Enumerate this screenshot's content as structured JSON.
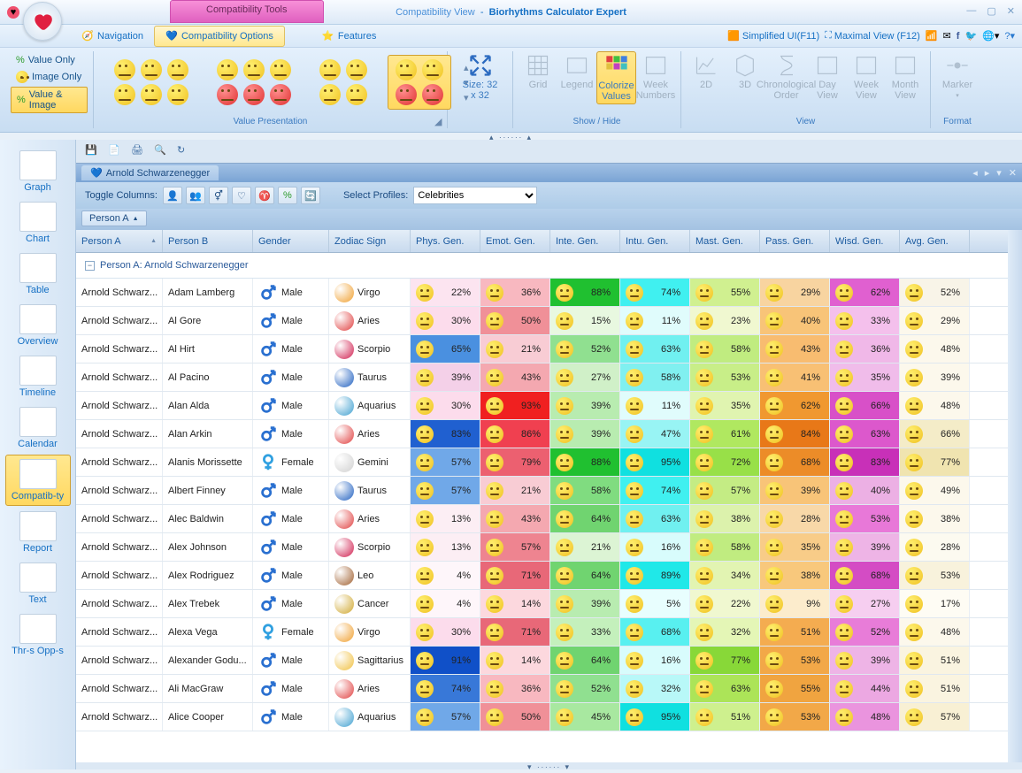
{
  "window": {
    "view_label": "Compatibility View",
    "separator": "-",
    "app_name": "Biorhythms Calculator Expert",
    "contextual_tab": "Compatibility Tools"
  },
  "tabs": {
    "navigation": "Navigation",
    "compat_options": "Compatibility Options",
    "features": "Features"
  },
  "topright": {
    "simplified": "Simplified UI(F11)",
    "maximal": "Maximal View (F12)"
  },
  "ribbon": {
    "value_presentation": {
      "label": "Value Presentation",
      "value_only": "Value Only",
      "image_only": "Image Only",
      "value_image": "Value & Image"
    },
    "size": {
      "label": "Size: 32 x 32"
    },
    "show_hide": {
      "label": "Show / Hide",
      "grid": "Grid",
      "legend": "Legend",
      "colorize": "Colorize Values",
      "week_numbers": "Week Numbers"
    },
    "view": {
      "label": "View",
      "d2": "2D",
      "d3": "3D",
      "chrono": "Chronological Order",
      "day": "Day View",
      "week": "Week View",
      "month": "Month View"
    },
    "format": {
      "label": "Format",
      "marker": "Marker"
    }
  },
  "sidebar": {
    "items": [
      "Graph",
      "Chart",
      "Table",
      "Overview",
      "Timeline",
      "Calendar",
      "Compatib-ty",
      "Report",
      "Text",
      "Thr-s Opp-s"
    ],
    "selected_index": 6
  },
  "doc_tab": {
    "title": "Arnold Schwarzenegger"
  },
  "filterbar": {
    "toggle_columns": "Toggle Columns:",
    "select_profiles": "Select Profiles:",
    "profiles_value": "Celebrities"
  },
  "groupby": {
    "chip": "Person A"
  },
  "columns": [
    "Person A",
    "Person B",
    "Gender",
    "Zodiac Sign",
    "Phys. Gen.",
    "Emot. Gen.",
    "Inte. Gen.",
    "Intu. Gen.",
    "Mast. Gen.",
    "Pass. Gen.",
    "Wisd. Gen.",
    "Avg. Gen."
  ],
  "group_header": "Person A:  Arnold Schwarzenegger",
  "rows": [
    {
      "a": "Arnold Schwarz...",
      "b": "Adam Lamberg",
      "gender": "Male",
      "zodiac": "Virgo",
      "zod_color": "#f0a030",
      "vals": [
        {
          "p": "22%",
          "c": "#fce4f0"
        },
        {
          "p": "36%",
          "c": "#f8b8c0"
        },
        {
          "p": "88%",
          "c": "#20c030"
        },
        {
          "p": "74%",
          "c": "#40f0f0"
        },
        {
          "p": "55%",
          "c": "#d0f090"
        },
        {
          "p": "29%",
          "c": "#f8d4a0"
        },
        {
          "p": "62%",
          "c": "#e060d0"
        },
        {
          "p": "52%",
          "c": "#f8f4e8"
        }
      ]
    },
    {
      "a": "Arnold Schwarz...",
      "b": "Al Gore",
      "gender": "Male",
      "zodiac": "Aries",
      "zod_color": "#e04040",
      "vals": [
        {
          "p": "30%",
          "c": "#fcdcec"
        },
        {
          "p": "50%",
          "c": "#f09098"
        },
        {
          "p": "15%",
          "c": "#e8f8e0"
        },
        {
          "p": "11%",
          "c": "#e0fcfc"
        },
        {
          "p": "23%",
          "c": "#f0f8d0"
        },
        {
          "p": "40%",
          "c": "#f8c478"
        },
        {
          "p": "33%",
          "c": "#f4c0ec"
        },
        {
          "p": "29%",
          "c": "#fcf8ec"
        }
      ]
    },
    {
      "a": "Arnold Schwarz...",
      "b": "Al Hirt",
      "gender": "Male",
      "zodiac": "Scorpio",
      "zod_color": "#d02050",
      "vals": [
        {
          "p": "65%",
          "c": "#4a90e0"
        },
        {
          "p": "21%",
          "c": "#f8ccd4"
        },
        {
          "p": "52%",
          "c": "#90e090"
        },
        {
          "p": "63%",
          "c": "#70f0f0"
        },
        {
          "p": "58%",
          "c": "#c0ec80"
        },
        {
          "p": "43%",
          "c": "#f8bc70"
        },
        {
          "p": "36%",
          "c": "#f0b8e8"
        },
        {
          "p": "48%",
          "c": "#fcf8ec"
        }
      ]
    },
    {
      "a": "Arnold Schwarz...",
      "b": "Al Pacino",
      "gender": "Male",
      "zodiac": "Taurus",
      "zod_color": "#2060c0",
      "vals": [
        {
          "p": "39%",
          "c": "#f4d0e8"
        },
        {
          "p": "43%",
          "c": "#f4a8b0"
        },
        {
          "p": "27%",
          "c": "#d0f0c8"
        },
        {
          "p": "58%",
          "c": "#80f0f0"
        },
        {
          "p": "53%",
          "c": "#c8ee88"
        },
        {
          "p": "41%",
          "c": "#f8c074"
        },
        {
          "p": "35%",
          "c": "#f0bcea"
        },
        {
          "p": "39%",
          "c": "#fcf8ec"
        }
      ]
    },
    {
      "a": "Arnold Schwarz...",
      "b": "Alan Alda",
      "gender": "Male",
      "zodiac": "Aquarius",
      "zod_color": "#40a0d0",
      "vals": [
        {
          "p": "30%",
          "c": "#fcdcec"
        },
        {
          "p": "93%",
          "c": "#f02020"
        },
        {
          "p": "39%",
          "c": "#b8ecb0"
        },
        {
          "p": "11%",
          "c": "#e0fcfc"
        },
        {
          "p": "35%",
          "c": "#e0f4b0"
        },
        {
          "p": "62%",
          "c": "#f09830"
        },
        {
          "p": "66%",
          "c": "#d850c8"
        },
        {
          "p": "48%",
          "c": "#fcf8ec"
        }
      ]
    },
    {
      "a": "Arnold Schwarz...",
      "b": "Alan Arkin",
      "gender": "Male",
      "zodiac": "Aries",
      "zod_color": "#e04040",
      "vals": [
        {
          "p": "83%",
          "c": "#2060d0"
        },
        {
          "p": "86%",
          "c": "#f04050"
        },
        {
          "p": "39%",
          "c": "#b8ecb0"
        },
        {
          "p": "47%",
          "c": "#98f4f4"
        },
        {
          "p": "61%",
          "c": "#b0e860"
        },
        {
          "p": "84%",
          "c": "#e87818"
        },
        {
          "p": "63%",
          "c": "#dc58cc"
        },
        {
          "p": "66%",
          "c": "#f4ecc8"
        }
      ]
    },
    {
      "a": "Arnold Schwarz...",
      "b": "Alanis Morissette",
      "gender": "Female",
      "zodiac": "Gemini",
      "zod_color": "#d0d0d0",
      "vals": [
        {
          "p": "57%",
          "c": "#70a8e8"
        },
        {
          "p": "79%",
          "c": "#ec6070"
        },
        {
          "p": "88%",
          "c": "#20c030"
        },
        {
          "p": "95%",
          "c": "#10e0e0"
        },
        {
          "p": "72%",
          "c": "#98e048"
        },
        {
          "p": "68%",
          "c": "#ec8c28"
        },
        {
          "p": "83%",
          "c": "#c830b8"
        },
        {
          "p": "77%",
          "c": "#f0e4b0"
        }
      ]
    },
    {
      "a": "Arnold Schwarz...",
      "b": "Albert Finney",
      "gender": "Male",
      "zodiac": "Taurus",
      "zod_color": "#2060c0",
      "vals": [
        {
          "p": "57%",
          "c": "#70a8e8"
        },
        {
          "p": "21%",
          "c": "#f8ccd4"
        },
        {
          "p": "58%",
          "c": "#80dc80"
        },
        {
          "p": "74%",
          "c": "#40f0f0"
        },
        {
          "p": "57%",
          "c": "#c4ec84"
        },
        {
          "p": "39%",
          "c": "#f8c478"
        },
        {
          "p": "40%",
          "c": "#ecb0e4"
        },
        {
          "p": "49%",
          "c": "#fcf8ec"
        }
      ]
    },
    {
      "a": "Arnold Schwarz...",
      "b": "Alec Baldwin",
      "gender": "Male",
      "zodiac": "Aries",
      "zod_color": "#e04040",
      "vals": [
        {
          "p": "13%",
          "c": "#fceef4"
        },
        {
          "p": "43%",
          "c": "#f4a8b0"
        },
        {
          "p": "64%",
          "c": "#70d470"
        },
        {
          "p": "63%",
          "c": "#70f0f0"
        },
        {
          "p": "38%",
          "c": "#dcf2ac"
        },
        {
          "p": "28%",
          "c": "#f8d8a8"
        },
        {
          "p": "53%",
          "c": "#e878d8"
        },
        {
          "p": "38%",
          "c": "#fcf8ec"
        }
      ]
    },
    {
      "a": "Arnold Schwarz...",
      "b": "Alex Johnson",
      "gender": "Male",
      "zodiac": "Scorpio",
      "zod_color": "#d02050",
      "vals": [
        {
          "p": "13%",
          "c": "#fceef4"
        },
        {
          "p": "57%",
          "c": "#ee8490"
        },
        {
          "p": "21%",
          "c": "#dcf4d4"
        },
        {
          "p": "16%",
          "c": "#d8fcfc"
        },
        {
          "p": "58%",
          "c": "#c0ec80"
        },
        {
          "p": "35%",
          "c": "#f8cc88"
        },
        {
          "p": "39%",
          "c": "#eeb4e6"
        },
        {
          "p": "28%",
          "c": "#fcfaf0"
        }
      ]
    },
    {
      "a": "Arnold Schwarz...",
      "b": "Alex Rodriguez",
      "gender": "Male",
      "zodiac": "Leo",
      "zod_color": "#a06030",
      "vals": [
        {
          "p": "4%",
          "c": "#fef6fa"
        },
        {
          "p": "71%",
          "c": "#e86878"
        },
        {
          "p": "64%",
          "c": "#70d470"
        },
        {
          "p": "89%",
          "c": "#20e8e8"
        },
        {
          "p": "34%",
          "c": "#e2f4b2"
        },
        {
          "p": "38%",
          "c": "#f8c87c"
        },
        {
          "p": "68%",
          "c": "#d44cc4"
        },
        {
          "p": "53%",
          "c": "#f8f2dc"
        }
      ]
    },
    {
      "a": "Arnold Schwarz...",
      "b": "Alex Trebek",
      "gender": "Male",
      "zodiac": "Cancer",
      "zod_color": "#d0a830",
      "vals": [
        {
          "p": "4%",
          "c": "#fef6fa"
        },
        {
          "p": "14%",
          "c": "#fcd8de"
        },
        {
          "p": "39%",
          "c": "#b8ecb0"
        },
        {
          "p": "5%",
          "c": "#e8fefe"
        },
        {
          "p": "22%",
          "c": "#f0f8d0"
        },
        {
          "p": "9%",
          "c": "#fceccc"
        },
        {
          "p": "27%",
          "c": "#f6cef0"
        },
        {
          "p": "17%",
          "c": "#fefcf4"
        }
      ]
    },
    {
      "a": "Arnold Schwarz...",
      "b": "Alexa Vega",
      "gender": "Female",
      "zodiac": "Virgo",
      "zod_color": "#f0a030",
      "vals": [
        {
          "p": "30%",
          "c": "#fcdcec"
        },
        {
          "p": "71%",
          "c": "#e86878"
        },
        {
          "p": "33%",
          "c": "#c4f0bc"
        },
        {
          "p": "68%",
          "c": "#58f0f0"
        },
        {
          "p": "32%",
          "c": "#e4f6b6"
        },
        {
          "p": "51%",
          "c": "#f4ac50"
        },
        {
          "p": "52%",
          "c": "#e87cd8"
        },
        {
          "p": "48%",
          "c": "#fcf8ec"
        }
      ]
    },
    {
      "a": "Arnold Schwarz...",
      "b": "Alexander Godu...",
      "gender": "Male",
      "zodiac": "Sagittarius",
      "zod_color": "#f0c040",
      "vals": [
        {
          "p": "91%",
          "c": "#1050c8"
        },
        {
          "p": "14%",
          "c": "#fcd8de"
        },
        {
          "p": "64%",
          "c": "#70d470"
        },
        {
          "p": "16%",
          "c": "#d8fcfc"
        },
        {
          "p": "77%",
          "c": "#88d838"
        },
        {
          "p": "53%",
          "c": "#f2a848"
        },
        {
          "p": "39%",
          "c": "#eeb4e6"
        },
        {
          "p": "51%",
          "c": "#faf4e0"
        }
      ]
    },
    {
      "a": "Arnold Schwarz...",
      "b": "Ali MacGraw",
      "gender": "Male",
      "zodiac": "Aries",
      "zod_color": "#e04040",
      "vals": [
        {
          "p": "74%",
          "c": "#3878d8"
        },
        {
          "p": "36%",
          "c": "#f8b8c0"
        },
        {
          "p": "52%",
          "c": "#90e090"
        },
        {
          "p": "32%",
          "c": "#b8f8f8"
        },
        {
          "p": "63%",
          "c": "#ace458"
        },
        {
          "p": "55%",
          "c": "#f0a440"
        },
        {
          "p": "44%",
          "c": "#eca8e2"
        },
        {
          "p": "51%",
          "c": "#faf4e0"
        }
      ]
    },
    {
      "a": "Arnold Schwarz...",
      "b": "Alice Cooper",
      "gender": "Male",
      "zodiac": "Aquarius",
      "zod_color": "#40a0d0",
      "vals": [
        {
          "p": "57%",
          "c": "#70a8e8"
        },
        {
          "p": "50%",
          "c": "#f09098"
        },
        {
          "p": "45%",
          "c": "#a8e8a0"
        },
        {
          "p": "95%",
          "c": "#10e0e0"
        },
        {
          "p": "51%",
          "c": "#cef08e"
        },
        {
          "p": "53%",
          "c": "#f2a848"
        },
        {
          "p": "48%",
          "c": "#ea94de"
        },
        {
          "p": "57%",
          "c": "#f8f0d4"
        }
      ]
    }
  ]
}
